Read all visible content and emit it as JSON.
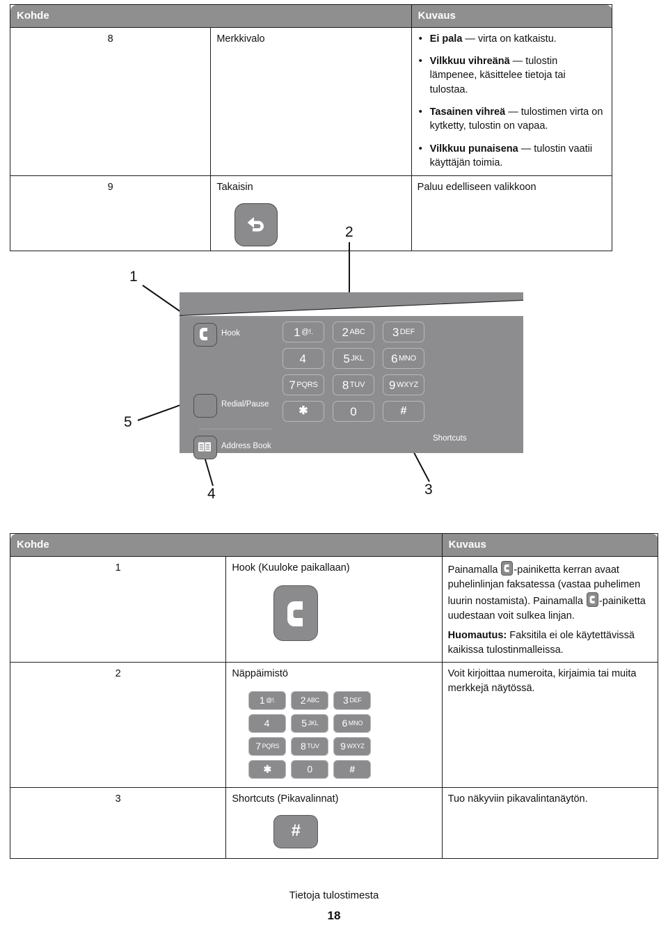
{
  "table_top": {
    "headers": [
      "Kohde",
      "Kuvaus"
    ],
    "rows": [
      {
        "num": "8",
        "name": "Merkkivalo",
        "bullets": [
          {
            "bold": "Ei pala",
            "rest": " — virta on katkaistu."
          },
          {
            "bold": "Vilkkuu vihreänä",
            "rest": " — tulostin lämpenee, käsittelee tietoja tai tulostaa."
          },
          {
            "bold": "Tasainen vihreä",
            "rest": " — tulostimen virta on kytketty, tulostin on vapaa."
          },
          {
            "bold": "Vilkkuu punaisena",
            "rest": " — tulostin vaatii käyttäjän toimia."
          }
        ]
      },
      {
        "num": "9",
        "name": "Takaisin",
        "desc": "Paluu edelliseen valikkoon",
        "icon": "back-arrow-icon"
      }
    ]
  },
  "diagram": {
    "callouts": [
      "1",
      "2",
      "3",
      "4",
      "5"
    ],
    "panel_buttons": [
      {
        "name": "hook",
        "label": "Hook",
        "icon": "phone-handset-icon"
      },
      {
        "name": "redial-pause",
        "label": "Redial/Pause",
        "icon": "blank-icon"
      },
      {
        "name": "address-book",
        "label": "Address Book",
        "icon": "address-book-icon"
      }
    ],
    "shortcuts_label": "Shortcuts",
    "keypad": [
      [
        {
          "digit": "1",
          "letters": "@!."
        },
        {
          "digit": "2",
          "letters": "ABC"
        },
        {
          "digit": "3",
          "letters": "DEF"
        }
      ],
      [
        {
          "digit": "4",
          "letters": ""
        },
        {
          "digit": "5",
          "letters": "JKL"
        },
        {
          "digit": "6",
          "letters": "MNO"
        }
      ],
      [
        {
          "digit": "7",
          "letters": "PQRS"
        },
        {
          "digit": "8",
          "letters": "TUV"
        },
        {
          "digit": "9",
          "letters": "WXYZ"
        }
      ],
      [
        {
          "digit": "✱",
          "letters": ""
        },
        {
          "digit": "0",
          "letters": ""
        },
        {
          "digit": "#",
          "letters": ""
        }
      ]
    ]
  },
  "table_bottom": {
    "headers": [
      "Kohde",
      "Kuvaus"
    ],
    "rows": [
      {
        "num": "1",
        "name": "Hook (Kuuloke paikallaan)",
        "desc_p1_a": "Painamalla ",
        "desc_p1_b": "-painiketta kerran avaat puhelinlinjan faksatessa (vastaa puhelimen luurin nostamista). Painamalla ",
        "desc_p1_c": "-painiketta uudestaan voit sulkea linjan.",
        "note_label": "Huomautus:",
        "note_text": " Faksitila ei ole käytettävissä kaikissa tulostinmalleissa."
      },
      {
        "num": "2",
        "name": "Näppäimistö",
        "desc": "Voit kirjoittaa numeroita, kirjaimia tai muita merkkejä näytössä."
      },
      {
        "num": "3",
        "name": "Shortcuts (Pikavalinnat)",
        "desc": "Tuo näkyviin pikavalintanäytön.",
        "icon_text": "#"
      }
    ]
  },
  "footer": {
    "title": "Tietoja tulostimesta",
    "page": "18"
  },
  "colors": {
    "header_gray": "#8f8f8f",
    "panel_gray": "#8d8d8f",
    "key_gray": "#8b8b8d",
    "border_dark": "#1c1c1c"
  }
}
